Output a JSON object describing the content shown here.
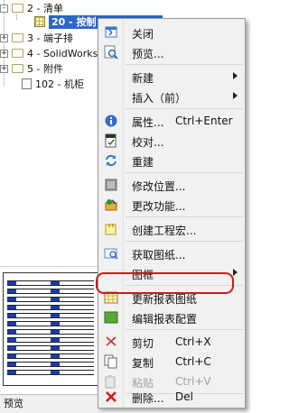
{
  "tree": {
    "items": [
      {
        "label": "2 - 清单",
        "expander": "-",
        "kind": "folder"
      },
      {
        "label": "20 - 按制",
        "kind": "grid",
        "selected": true
      },
      {
        "label": "3 - 端子排",
        "expander": "+",
        "kind": "folder"
      },
      {
        "label": "4 - SolidWorks",
        "expander": "+",
        "kind": "folder"
      },
      {
        "label": "5 - 附件",
        "expander": "+",
        "kind": "folder"
      },
      {
        "label": "102 - 机柜",
        "kind": "sheet"
      }
    ]
  },
  "preview": {
    "tab_label": "预览"
  },
  "context_menu": {
    "items": [
      {
        "label": "关闭",
        "icon": "close-window-icon"
      },
      {
        "label": "预览...",
        "icon": "preview-magnifier-icon"
      },
      {
        "label": "新建",
        "submenu": true
      },
      {
        "label": "插入（前）",
        "submenu": true
      },
      {
        "label": "属性...",
        "shortcut": "Ctrl+Enter",
        "icon": "info-icon"
      },
      {
        "label": "校对...",
        "icon": "checklist-icon"
      },
      {
        "label": "重建",
        "icon": "refresh-icon"
      },
      {
        "label": "修改位置...",
        "icon": "location-icon"
      },
      {
        "label": "更改功能...",
        "icon": "function-icon"
      },
      {
        "label": "创建工程宏...",
        "icon": "macro-icon"
      },
      {
        "label": "获取图纸...",
        "icon": "get-drawing-icon"
      },
      {
        "label": "图框",
        "submenu": true
      },
      {
        "label": "更新报表图纸",
        "icon": "report-grid-icon",
        "highlighted": true
      },
      {
        "label": "编辑报表配置",
        "icon": "report-config-icon"
      },
      {
        "label": "剪切",
        "shortcut": "Ctrl+X",
        "icon": "cut-icon"
      },
      {
        "label": "复制",
        "shortcut": "Ctrl+C",
        "icon": "copy-icon"
      },
      {
        "label": "粘贴",
        "shortcut": "Ctrl+V",
        "icon": "paste-icon",
        "disabled": true
      },
      {
        "label": "删除...",
        "shortcut": "Del",
        "icon": "delete-icon"
      }
    ]
  },
  "colors": {
    "selection": "#2a66c8",
    "highlight_circle": "#d01818",
    "menu_bg": "#f1f1f1"
  }
}
